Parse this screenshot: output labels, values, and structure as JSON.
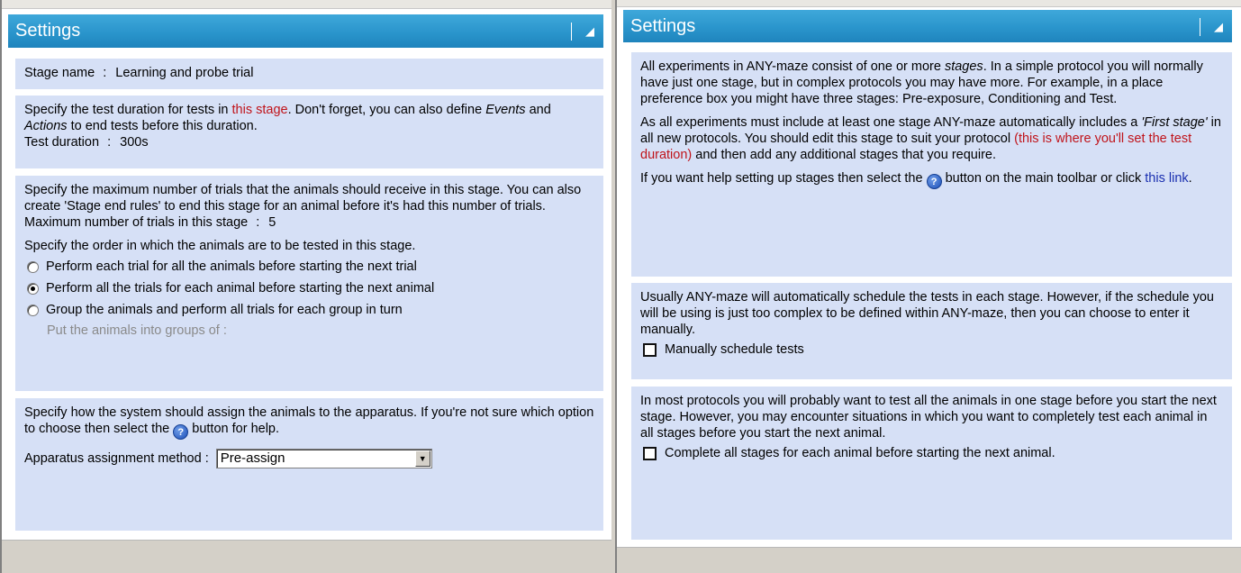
{
  "left": {
    "title": "Settings",
    "pin_icon": "pin-icon",
    "stage_name_label": "Stage name",
    "stage_name_sep": ":",
    "stage_name_value": "Learning and probe trial",
    "duration": {
      "text_1": "Specify the test duration for tests in ",
      "link": "this stage",
      "text_2": ". Don't forget, you can also define ",
      "events": "Events",
      "and": " and ",
      "actions": "Actions",
      "text_3": " to end tests before this duration.",
      "label": "Test duration",
      "sep": ":",
      "value": "300s"
    },
    "trials": {
      "text": "Specify the maximum number of trials that the animals should receive in this stage. You can also create 'Stage end rules' to end this stage for an animal before it's had this number of trials.",
      "max_label": "Maximum number of trials in this stage",
      "max_sep": ":",
      "max_value": "5",
      "order_text": "Specify the order in which the animals are to be tested in this stage.",
      "options": [
        "Perform each trial for all the animals before starting the next trial",
        "Perform all the trials for each animal before starting the next animal",
        "Group the animals and perform all trials for each group in turn"
      ],
      "selected_index": 1,
      "groups_label": "Put the animals into groups of :"
    },
    "apparatus": {
      "text_1": "Specify how the system should  assign the animals to the apparatus.  If you're not sure which option to choose then select the ",
      "text_2": " button for help.",
      "method_label": "Apparatus assignment method :",
      "method_value": "Pre-assign"
    }
  },
  "right": {
    "title": "Settings",
    "pin_icon": "pin-icon",
    "stages": {
      "p1_a": "All experiments in ANY-maze consist of one or more ",
      "p1_em": "stages",
      "p1_b": ". In a simple protocol you will normally have just one stage, but in complex protocols you may have more. For example, in a place preference box you might have three stages: Pre-exposure, Conditioning and Test.",
      "p2_a": "As all experiments must include at least one stage ANY-maze automatically includes a ",
      "p2_em": "'First stage'",
      "p2_b": " in all new protocols. You should edit this stage to suit your protocol ",
      "p2_red": "(this is where you'll set the test duration)",
      "p2_c": " and then add any additional stages that you require.",
      "p3_a": "If you want help setting up stages then select the ",
      "p3_b": " button on the main toolbar or click ",
      "p3_link": "this link",
      "p3_c": "."
    },
    "schedule": {
      "text": "Usually ANY-maze will automatically schedule the tests in each stage. However, if the schedule you will be using is just too complex to be defined within ANY-maze, then you can choose to enter it manually.",
      "checkbox_label": "Manually schedule tests",
      "checked": false
    },
    "complete": {
      "text": "In most protocols you will probably want to test all the animals in one stage before you start the next stage.  However, you may encounter situations in which you want to completely test each animal in all stages before you start the next animal.",
      "checkbox_label": "Complete all stages for each animal before starting the next animal.",
      "checked": false
    }
  }
}
